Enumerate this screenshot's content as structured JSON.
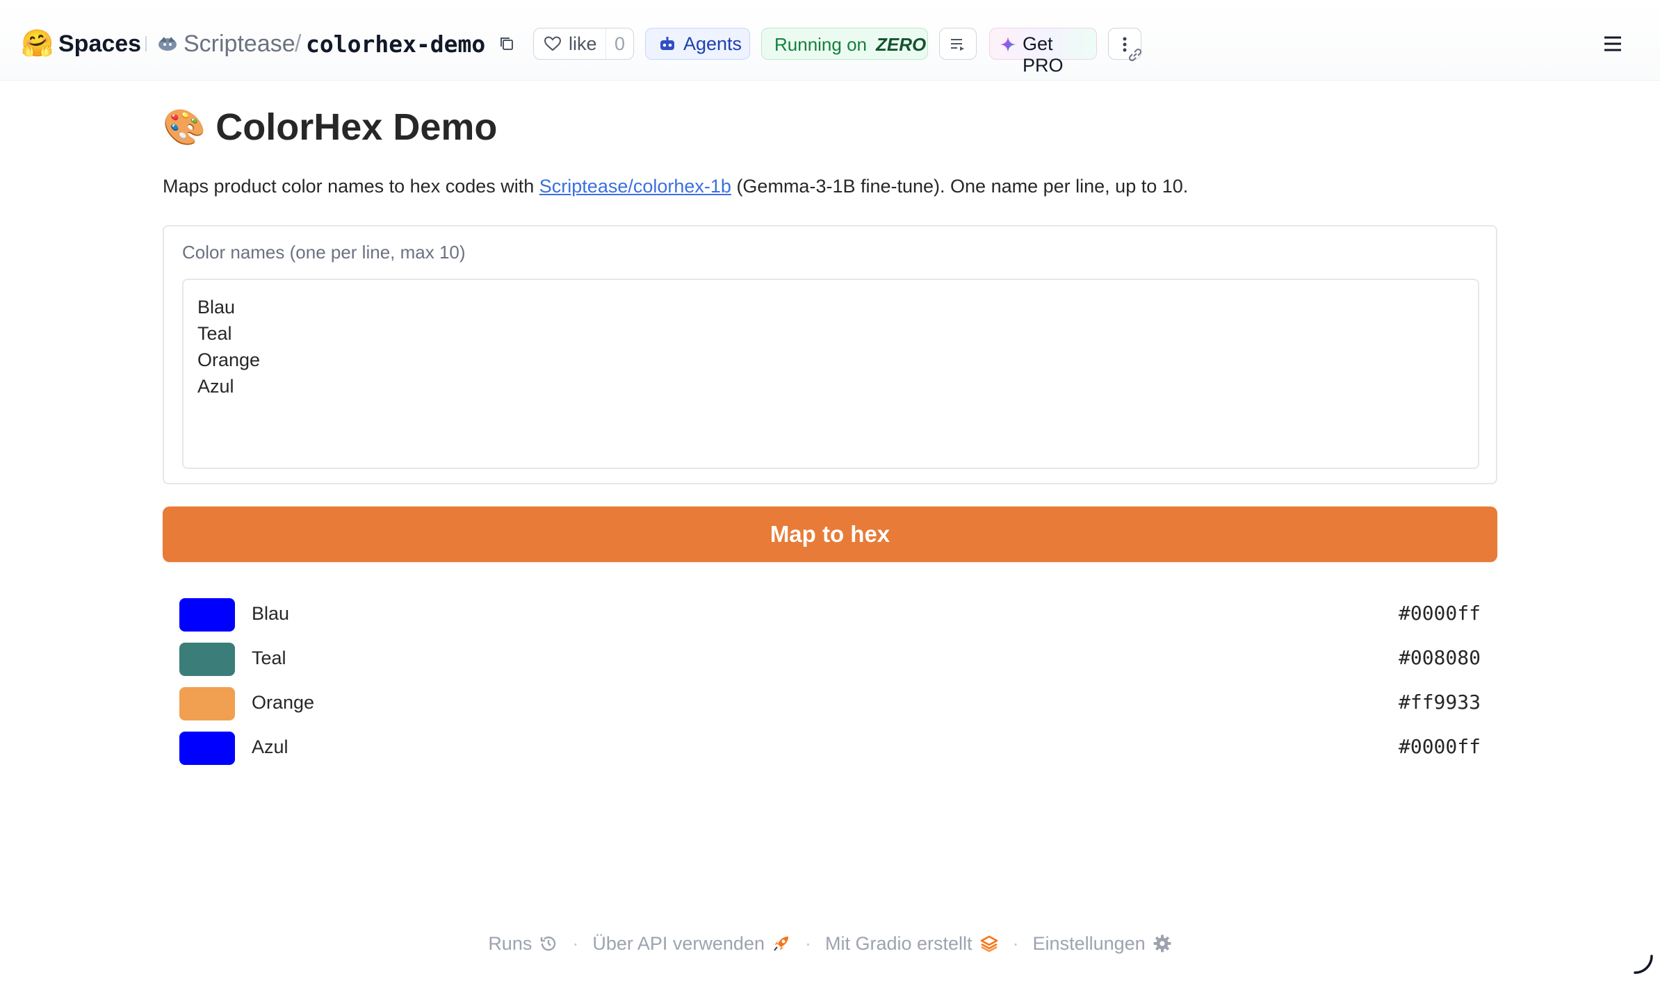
{
  "header": {
    "logo_emoji": "🤗",
    "spaces_label": "Spaces",
    "owner": "Scriptease",
    "separator": "/",
    "repo": "colorhex-demo",
    "like_label": "like",
    "like_count": "0",
    "agents_label": "Agents",
    "running_label": "Running on",
    "running_hardware": "ZERO",
    "pro_label": "Get PRO"
  },
  "app": {
    "title_emoji": "🎨",
    "title": "ColorHex Demo",
    "description_before": "Maps product color names to hex codes with ",
    "description_link": "Scriptease/colorhex-1b",
    "description_after": " (Gemma-3-1B fine-tune). One name per line, up to 10.",
    "input_label": "Color names (one per line, max 10)",
    "input_lines": [
      "Blau",
      "Teal",
      "Orange",
      "Azul"
    ],
    "submit_label": "Map to hex"
  },
  "results": [
    {
      "name": "Blau",
      "hex": "#0000ff",
      "swatch_color": "#0000ff"
    },
    {
      "name": "Teal",
      "hex": "#008080",
      "swatch_color": "#3b7d78"
    },
    {
      "name": "Orange",
      "hex": "#ff9933",
      "swatch_color": "#f0a050"
    },
    {
      "name": "Azul",
      "hex": "#0000ff",
      "swatch_color": "#0000ff"
    }
  ],
  "footer": {
    "runs": "Runs",
    "api": "Über API verwenden",
    "built_with": "Mit Gradio erstellt",
    "settings": "Einstellungen"
  },
  "colors": {
    "accent_button": "#e87b37",
    "link": "#3b6fe0",
    "running_badge": "#15803d"
  }
}
